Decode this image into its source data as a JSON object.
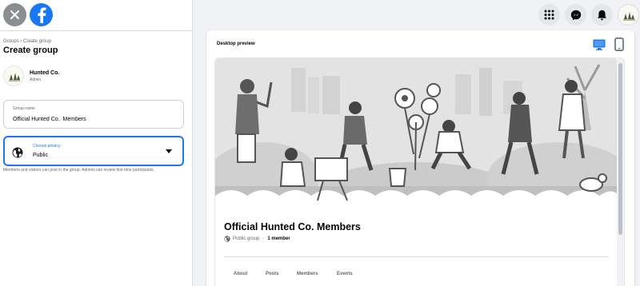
{
  "sidebar": {
    "breadcrumb": "Groups › Create group",
    "title": "Create group",
    "admin": {
      "name": "Hunted Co.",
      "role": "Admin"
    },
    "group_name": {
      "label": "Group name",
      "value": "Official Hunted Co.  Members"
    },
    "privacy": {
      "label": "Choose privacy",
      "value": "Public",
      "help": "Members and visitors can post in the group. Admins can review first-time participants."
    }
  },
  "topbar": {
    "icons": [
      "menu-grid-icon",
      "messenger-icon",
      "notifications-bell-icon",
      "profile-avatar"
    ]
  },
  "preview": {
    "label": "Desktop preview",
    "modes": [
      "desktop",
      "mobile"
    ],
    "active_mode": "desktop",
    "group": {
      "title": "Official Hunted Co. Members",
      "privacy": "Public group",
      "separator": "·",
      "members": "1 member"
    },
    "tabs": [
      "About",
      "Posts",
      "Members",
      "Events"
    ]
  },
  "colors": {
    "accent": "#1877f2",
    "page_bg": "#f0f2f5",
    "muted_text": "#65676b",
    "cover_bg": "#e6e6e6"
  }
}
